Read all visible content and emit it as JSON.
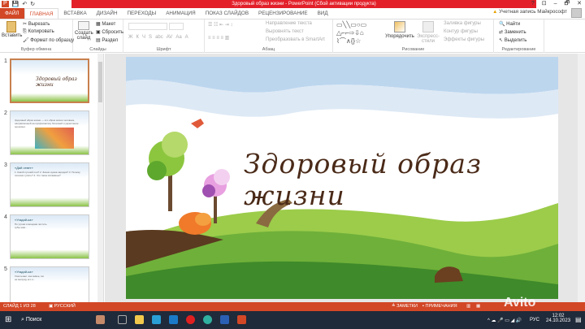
{
  "window": {
    "title": "Здоровый образ жизни - PowerPoint (Сбой активации продукта)",
    "controls": [
      "?",
      "⊡",
      "–",
      "🗗",
      "✕"
    ]
  },
  "tabs": [
    "ФАЙЛ",
    "ГЛАВНАЯ",
    "ВСТАВКА",
    "ДИЗАЙН",
    "ПЕРЕХОДЫ",
    "АНИМАЦИЯ",
    "ПОКАЗ СЛАЙДОВ",
    "РЕЦЕНЗИРОВАНИЕ",
    "ВИД"
  ],
  "account": "Учетная запись Майкрософт",
  "ribbon": {
    "clipboard": {
      "paste": "Вставить",
      "cut": "Вырезать",
      "copy": "Копировать",
      "format": "Формат по образцу",
      "label": "Буфер обмена"
    },
    "slides": {
      "new": "Создать слайд",
      "layout": "Макет",
      "reset": "Сбросить",
      "section": "Раздел",
      "label": "Слайды"
    },
    "font": {
      "label": "Шрифт",
      "buttons": [
        "Ж",
        "К",
        "Ч",
        "S",
        "abc",
        "AV",
        "Aa",
        "A"
      ]
    },
    "paragraph": {
      "direction": "Направление текста",
      "align": "Выровнять текст",
      "smartart": "Преобразовать в SmartArt",
      "label": "Абзац"
    },
    "drawing": {
      "arrange": "Упорядочить",
      "styles": "Экспресс-стили",
      "fill": "Заливка фигуры",
      "outline": "Контур фигуры",
      "effects": "Эффекты фигуры",
      "label": "Рисование"
    },
    "editing": {
      "find": "Найти",
      "replace": "Заменить",
      "select": "Выделить",
      "label": "Редактирование"
    }
  },
  "thumbnails": [
    {
      "num": "1",
      "title": "Здоровый образ жизни"
    },
    {
      "num": "2",
      "title": "",
      "text": "Здоровый образ жизни — это образ жизни человека, направленный на профилактику болезней и укрепление здоровья."
    },
    {
      "num": "3",
      "title": "«Дай ответ»",
      "text": "1. Какой лучший сон? 2. Зачем нужна зарядка? 3. Почему полезно гулять? 4. Что такое витамины?"
    },
    {
      "num": "4",
      "title": "«Угадай-ка»",
      "text": "По утрам и вечерам чистить зубы нам..."
    },
    {
      "num": "5",
      "title": "«Угадай-ка»",
      "text": "Ускользает, как живое, Но не выпущу его я..."
    }
  ],
  "slide": {
    "title": "Здоровый образ жизни"
  },
  "status": {
    "slide": "СЛАЙД 1 ИЗ 28",
    "lang": "РУССКИЙ",
    "notes": "ЗАМЕТКИ",
    "comments": "ПРИМЕЧАНИЯ"
  },
  "taskbar": {
    "search": "Поиск",
    "lang": "РУС",
    "time": "12:02",
    "date": "24.10.2023"
  },
  "watermark": "Avito"
}
